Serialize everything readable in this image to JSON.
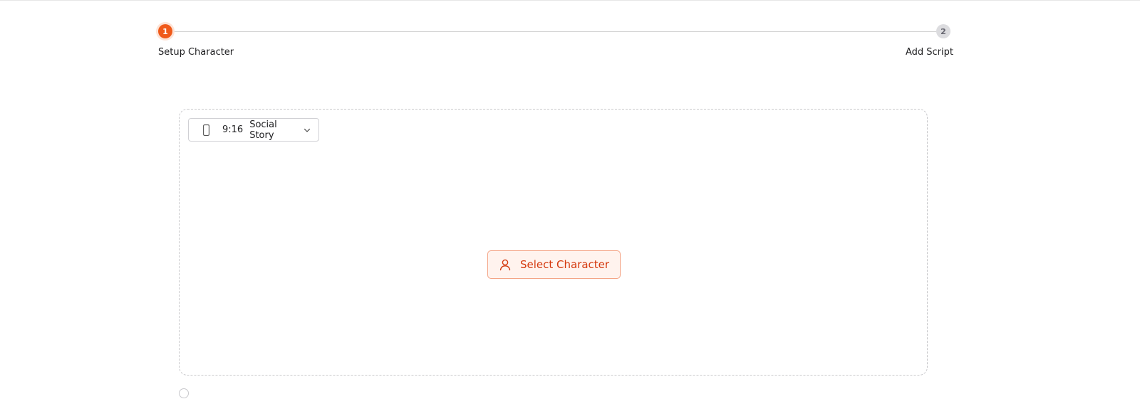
{
  "stepper": {
    "steps": [
      {
        "number": "1",
        "label": "Setup Character",
        "state": "active"
      },
      {
        "number": "2",
        "label": "Add Script",
        "state": "inactive"
      }
    ]
  },
  "canvas": {
    "ratio_select": {
      "icon": "phone-icon",
      "ratio": "9:16",
      "name": "Social Story",
      "chevron_icon": "chevron-down-icon"
    },
    "select_character": {
      "icon": "user-icon",
      "label": "Select Character"
    }
  },
  "colors": {
    "accent": "#f05a1a",
    "accent_text": "#d4380d",
    "accent_bg": "#fff3ee",
    "inactive_step": "#dcdcdf"
  }
}
